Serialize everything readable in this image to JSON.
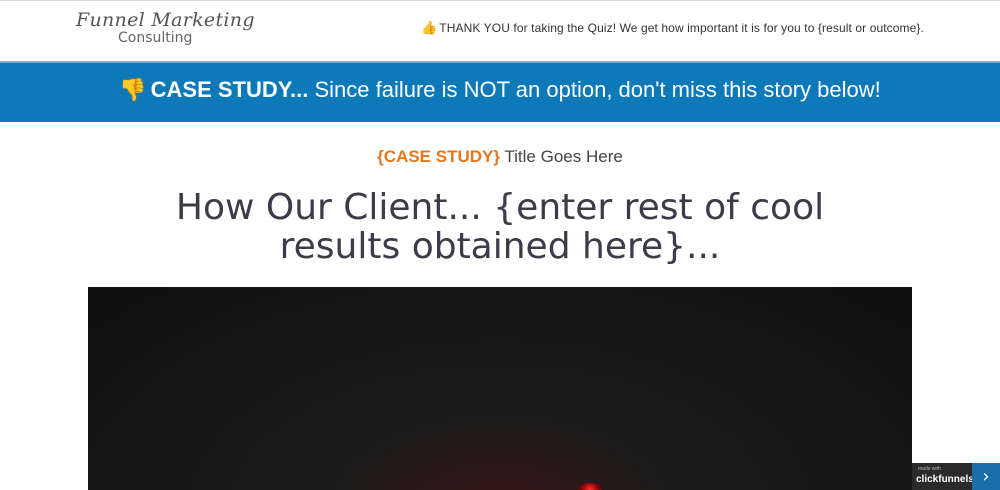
{
  "header": {
    "logo_line1": "Funnel Marketing",
    "logo_line2": "Consulting",
    "thanks_text": "THANK YOU for taking the Quiz! We get how important it is for you to {result or outcome}."
  },
  "banner": {
    "bold": "CASE STUDY...",
    "text": " Since failure is NOT an option, don't miss this story below!"
  },
  "main": {
    "subtitle_accent": "{CASE STUDY}",
    "subtitle_rest": " Title Goes Here",
    "headline": "How Our Client... {enter rest of cool results obtained here}..."
  },
  "badge": {
    "small": "made with",
    "big": "clickfunnels",
    "arrow": "›"
  },
  "colors": {
    "banner_bg": "#0d79b8",
    "accent_orange": "#e8751a",
    "headline": "#3b3b4a"
  },
  "icons": {
    "thumb": "thumbs-up-icon",
    "pointing_hand": "pointing-down-hand-icon"
  }
}
